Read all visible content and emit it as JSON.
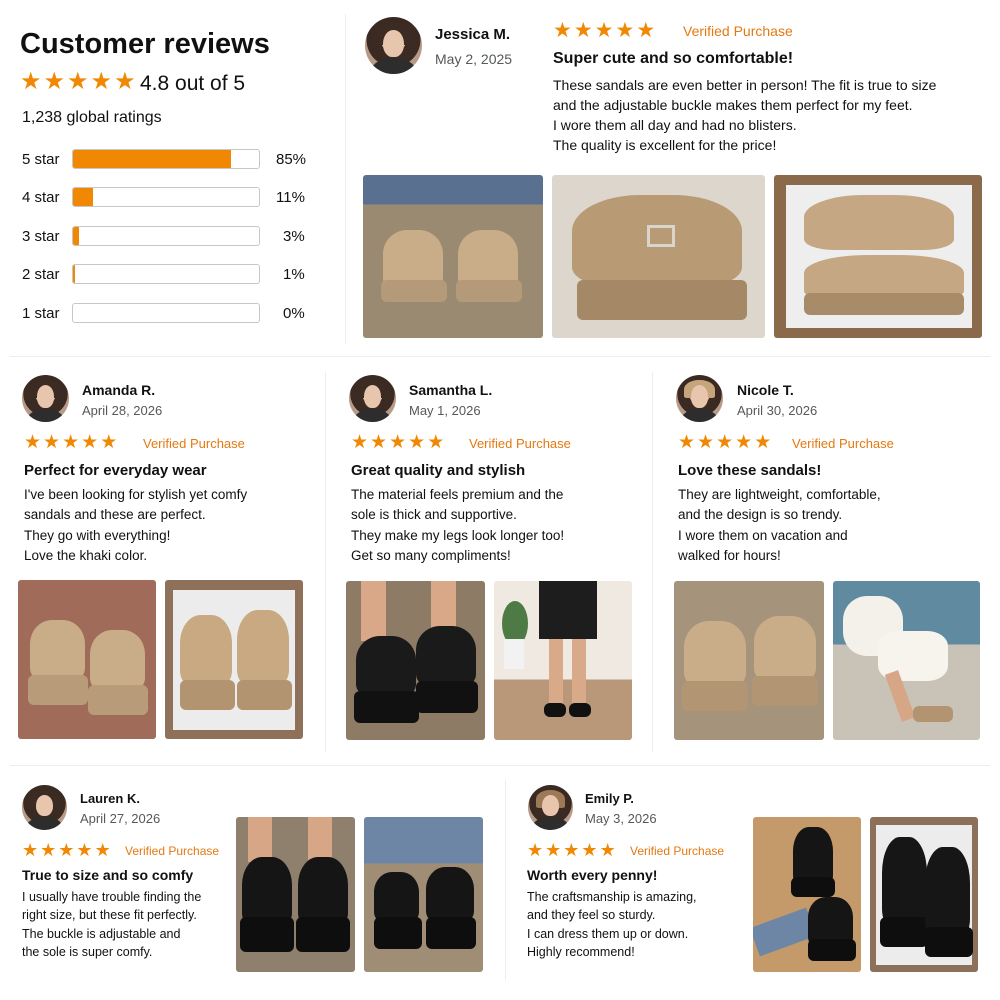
{
  "summary": {
    "heading": "Customer reviews",
    "rating_text": "4.8 out of 5",
    "global_ratings": "1,238 global ratings",
    "bars": [
      {
        "label": "5 star",
        "percent_text": "85%",
        "fraction": 0.85
      },
      {
        "label": "4 star",
        "percent_text": "11%",
        "fraction": 0.11
      },
      {
        "label": "3 star",
        "percent_text": "3%",
        "fraction": 0.03
      },
      {
        "label": "2 star",
        "percent_text": "1%",
        "fraction": 0.01
      },
      {
        "label": "1 star",
        "percent_text": "0%",
        "fraction": 0.0
      }
    ]
  },
  "star_glyph": "★",
  "accent_color": "#f08804",
  "verified_color": "#e47911",
  "reviews": [
    {
      "name": "Jessica M.",
      "date": "May 2, 2025",
      "verified": "Verified Purchase",
      "title": "Super cute and so comfortable!",
      "lines": [
        "These sandals are even better in person! The fit is true to size",
        "and the adjustable buckle makes them perfect for my feet.",
        "I wore them all day and had no blisters.",
        "The quality is excellent for the price!"
      ]
    },
    {
      "name": "Amanda R.",
      "date": "April 28, 2026",
      "verified": "Verified Purchase",
      "title": "Perfect for everyday wear",
      "lines": [
        "I've been looking for stylish yet comfy",
        "sandals and these are perfect.",
        "They go with everything!",
        "Love the khaki color."
      ]
    },
    {
      "name": "Samantha L.",
      "date": "May 1, 2026",
      "verified": "Verified Purchase",
      "title": "Great quality and stylish",
      "lines": [
        "The material feels premium and the",
        "sole is thick and supportive.",
        "They make my legs look longer too!",
        "Get so many compliments!"
      ]
    },
    {
      "name": "Nicole T.",
      "date": "April 30, 2026",
      "verified": "Verified Purchase",
      "title": "Love these sandals!",
      "lines": [
        "They are lightweight, comfortable,",
        "and the design is so trendy.",
        "I wore them on vacation and",
        "walked for hours!"
      ]
    },
    {
      "name": "Lauren K.",
      "date": "April 27, 2026",
      "verified": "Verified Purchase",
      "title": "True to size and so comfy",
      "lines": [
        "I usually have trouble finding the",
        "right size, but these fit perfectly.",
        "The buckle is adjustable and",
        "the sole is super comfy."
      ]
    },
    {
      "name": "Emily P.",
      "date": "May 3, 2026",
      "verified": "Verified Purchase",
      "title": "Worth every penny!",
      "lines": [
        "The craftsmanship is amazing,",
        "and they feel so sturdy.",
        "I can dress them up or down.",
        "Highly recommend!"
      ]
    }
  ]
}
